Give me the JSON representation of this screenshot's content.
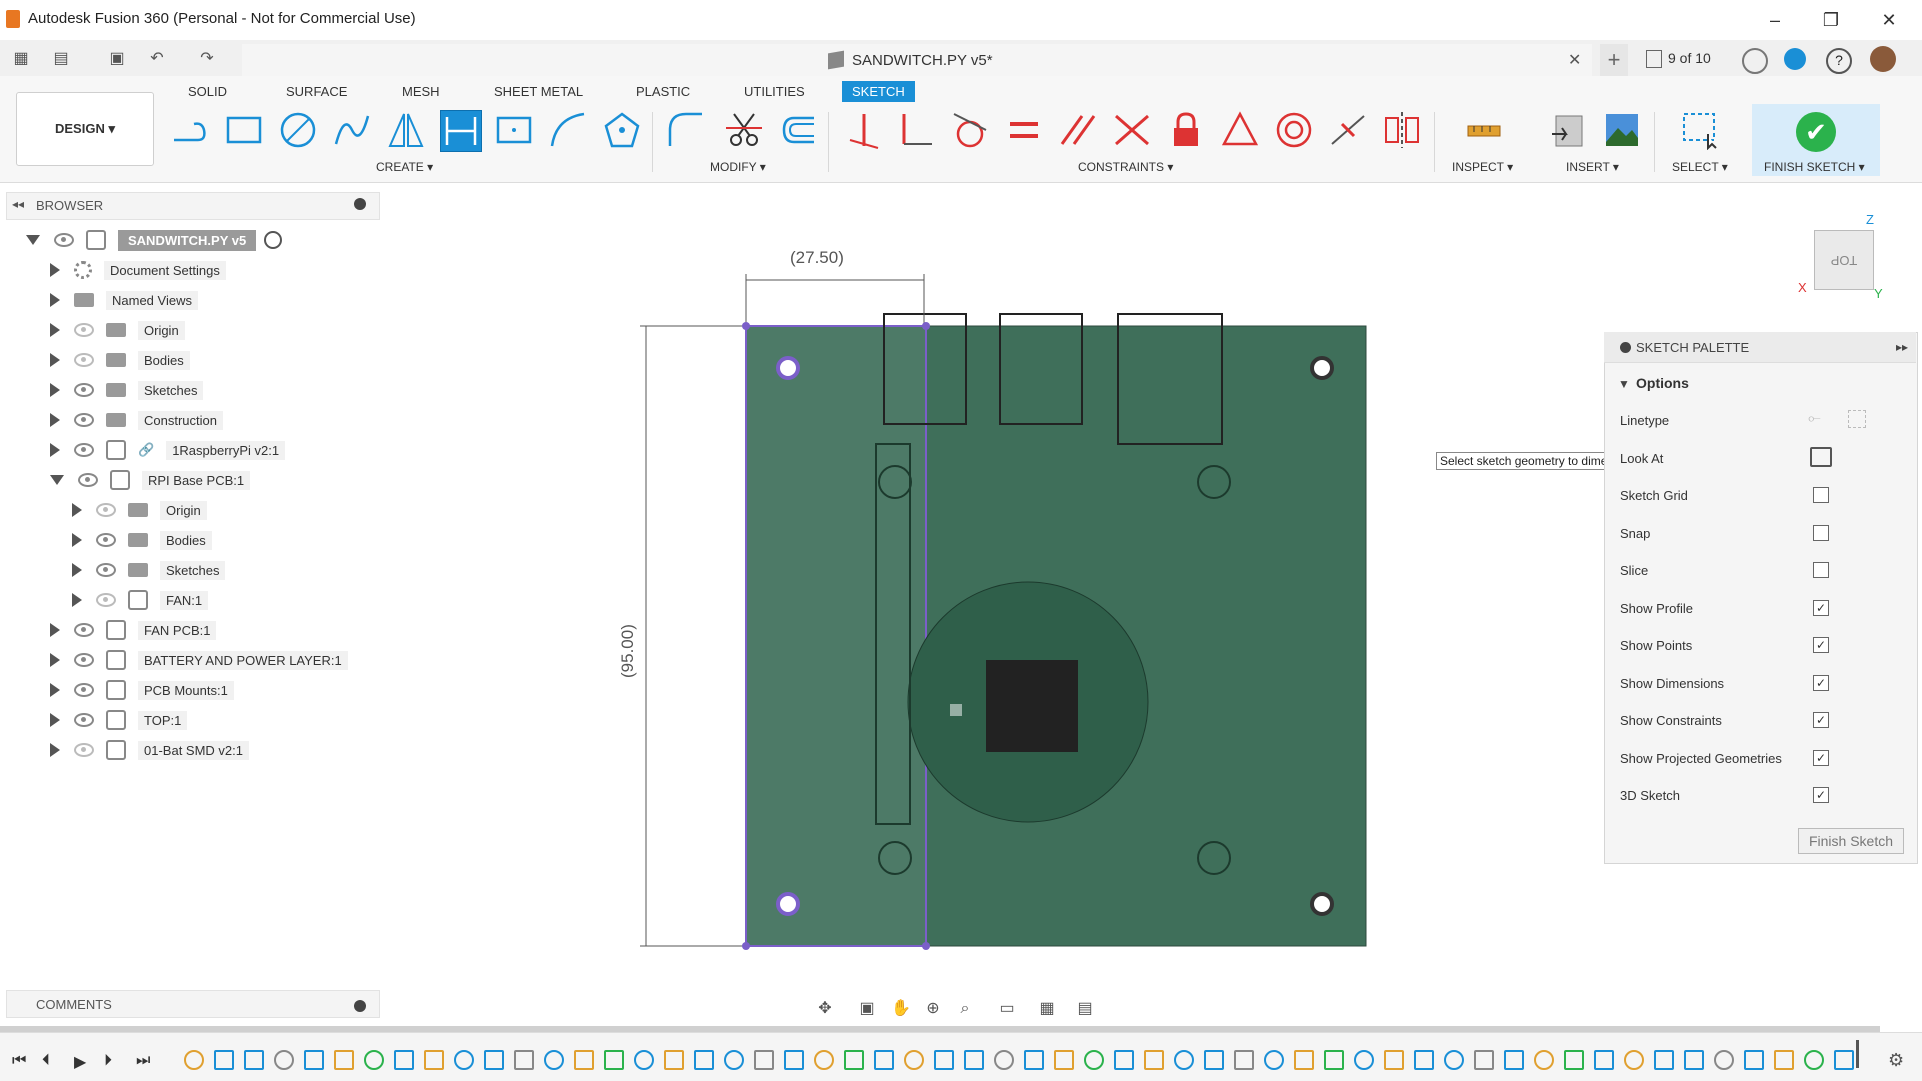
{
  "window": {
    "title": "Autodesk Fusion 360 (Personal - Not for Commercial Use)",
    "minimize": "–",
    "restore": "❐",
    "close": "✕"
  },
  "doc_tab": {
    "title": "SANDWITCH.PY v5*",
    "close": "✕",
    "new": "+",
    "versions": "9 of 10"
  },
  "workspace": {
    "label": "DESIGN ▾"
  },
  "tabs": [
    "SOLID",
    "SURFACE",
    "MESH",
    "SHEET METAL",
    "PLASTIC",
    "UTILITIES",
    "SKETCH"
  ],
  "groups": {
    "create": "CREATE ▾",
    "modify": "MODIFY ▾",
    "constraints": "CONSTRAINTS ▾",
    "inspect": "INSPECT ▾",
    "insert": "INSERT ▾",
    "select": "SELECT ▾",
    "finish": "FINISH SKETCH ▾"
  },
  "browser": {
    "title": "BROWSER",
    "root": "SANDWITCH.PY v5",
    "items": [
      {
        "label": "Document Settings",
        "icon": "gear-icon",
        "level": 1,
        "visible": null
      },
      {
        "label": "Named Views",
        "icon": "folder-icon",
        "level": 1,
        "visible": null
      },
      {
        "label": "Origin",
        "icon": "folder-icon",
        "level": 1,
        "visible": false
      },
      {
        "label": "Bodies",
        "icon": "folder-icon",
        "level": 1,
        "visible": false
      },
      {
        "label": "Sketches",
        "icon": "folder-icon",
        "level": 1,
        "visible": true
      },
      {
        "label": "Construction",
        "icon": "folder-icon",
        "level": 1,
        "visible": true
      },
      {
        "label": "1RaspberryPi v2:1",
        "icon": "link-icon",
        "level": 1,
        "visible": true
      },
      {
        "label": "RPI Base PCB:1",
        "icon": "component-icon",
        "level": 1,
        "visible": true,
        "expanded": true
      },
      {
        "label": "Origin",
        "icon": "folder-icon",
        "level": 2,
        "visible": false
      },
      {
        "label": "Bodies",
        "icon": "folder-icon",
        "level": 2,
        "visible": true
      },
      {
        "label": "Sketches",
        "icon": "folder-icon",
        "level": 2,
        "visible": true
      },
      {
        "label": "FAN:1",
        "icon": "component-icon",
        "level": 2,
        "visible": false
      },
      {
        "label": "FAN PCB:1",
        "icon": "component-icon",
        "level": 1,
        "visible": true
      },
      {
        "label": "BATTERY AND POWER LAYER:1",
        "icon": "component-icon",
        "level": 1,
        "visible": true
      },
      {
        "label": "PCB Mounts:1",
        "icon": "component-icon",
        "level": 1,
        "visible": true
      },
      {
        "label": "TOP:1",
        "icon": "component-icon",
        "level": 1,
        "visible": true
      },
      {
        "label": "01-Bat SMD v2:1",
        "icon": "component-icon",
        "level": 1,
        "visible": false
      }
    ]
  },
  "comments": {
    "title": "COMMENTS"
  },
  "canvas": {
    "dim_horizontal": "(27.50)",
    "dim_vertical": "(95.00)",
    "tooltip": "Select sketch geometry to dimension",
    "viewcube_face": "TOP",
    "axis_x": "X",
    "axis_z": "Z",
    "axis_y": "Y"
  },
  "palette": {
    "title": "SKETCH PALETTE",
    "section": "Options",
    "linetype_label": "Linetype",
    "look_at_label": "Look At",
    "options": [
      {
        "label": "Sketch Grid",
        "checked": false
      },
      {
        "label": "Snap",
        "checked": false
      },
      {
        "label": "Slice",
        "checked": false
      },
      {
        "label": "Show Profile",
        "checked": true
      },
      {
        "label": "Show Points",
        "checked": true
      },
      {
        "label": "Show Dimensions",
        "checked": true
      },
      {
        "label": "Show Constraints",
        "checked": true
      },
      {
        "label": "Show Projected Geometries",
        "checked": true
      },
      {
        "label": "3D Sketch",
        "checked": true
      }
    ],
    "finish_button": "Finish Sketch"
  },
  "colors": {
    "accent": "#1a8fd6",
    "pcb_green": "#3f6f5a",
    "selection": "#7b5fc9",
    "finish_green": "#2bb24c"
  }
}
